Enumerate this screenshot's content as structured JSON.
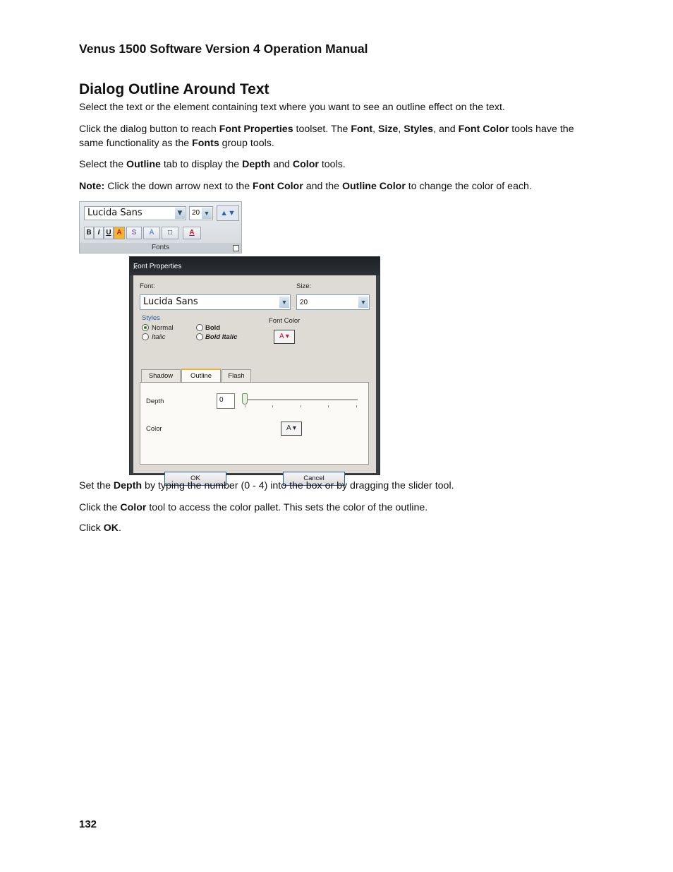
{
  "header": {
    "doc_title": "Venus 1500 Software Version 4 Operation Manual"
  },
  "section": {
    "heading": "Dialog Outline Around Text"
  },
  "paragraphs": {
    "p1": "Select the text or the element containing text where you want to see an outline effect on the text.",
    "p2": {
      "t1": "Click the dialog button to reach ",
      "b1": "Font Properties",
      "t2": " toolset. The ",
      "b2": "Font",
      "t3": ", ",
      "b3": "Size",
      "t4": ", ",
      "b4": "Styles",
      "t5": ", and ",
      "b5": "Font Color",
      "t6": " tools have the same functionality as the ",
      "b6": "Fonts",
      "t7": " group tools."
    },
    "p3": {
      "t1": "Select the ",
      "b1": "Outline",
      "t2": " tab to display the ",
      "b2": "Depth",
      "t3": " and ",
      "b3": "Color",
      "t4": " tools."
    },
    "p4": {
      "b1": "Note:",
      "t1": " Click the down arrow next to the ",
      "b2": "Font Color",
      "t2": " and the ",
      "b3": "Outline Color",
      "t3": " to change the color of each."
    },
    "p5": {
      "t1": "Set the ",
      "b1": "Depth",
      "t2": " by typing the number (0 - 4) into the box or by dragging the slider tool."
    },
    "p6": {
      "t1": "Click the ",
      "b1": "Color",
      "t2": " tool to access the color pallet. This sets the color of the outline."
    },
    "p7": {
      "t1": "Click ",
      "b1": "OK",
      "t2": "."
    }
  },
  "ribbon": {
    "font_value": "Lucida Sans",
    "size_value": "20",
    "grow_icon": "▲▼",
    "buttons": [
      "B",
      "I",
      "U",
      "A",
      "S",
      "A",
      "□",
      "A"
    ],
    "group_label": "Fonts"
  },
  "dialog": {
    "title": "Font Properties",
    "close": "x",
    "font_label": "Font:",
    "font_value": "Lucida Sans",
    "size_label": "Size:",
    "size_value": "20",
    "styles_label": "Styles",
    "style_normal": "Normal",
    "style_italic": "Italic",
    "style_bold": "Bold",
    "style_bold_italic": "Bold Italic",
    "font_color_label": "Font Color",
    "color_glyph": "A ▾",
    "tabs": [
      "Shadow",
      "Outline",
      "Flash"
    ],
    "depth_label": "Depth",
    "depth_value": "0",
    "color_label": "Color",
    "ok_label": "OK",
    "cancel_label": "Cancel",
    "colors": {
      "accent_tab": "#f2b134",
      "font_color": "#c0143c",
      "title_bar": "#1d2024"
    }
  },
  "footer": {
    "page_number": "132"
  }
}
